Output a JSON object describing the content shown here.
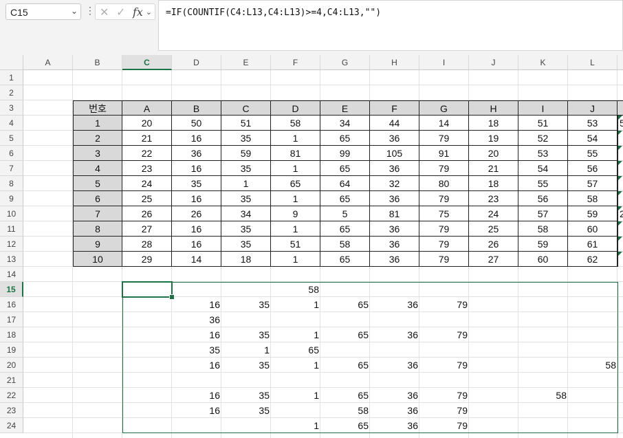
{
  "name_box": {
    "value": "C15"
  },
  "formula_bar": {
    "formula": "=IF(COUNTIF(C4:L13,C4:L13)>=4,C4:L13,\"\")"
  },
  "column_headers": [
    "A",
    "B",
    "C",
    "D",
    "E",
    "F",
    "G",
    "H",
    "I",
    "J",
    "K",
    "L"
  ],
  "row_headers": [
    "1",
    "2",
    "3",
    "4",
    "5",
    "6",
    "7",
    "8",
    "9",
    "10",
    "11",
    "12",
    "13",
    "14",
    "15",
    "16",
    "17",
    "18",
    "19",
    "20",
    "21",
    "22",
    "23",
    "24"
  ],
  "selected": {
    "column": "C",
    "row": "15"
  },
  "table": {
    "header": [
      "번호",
      "A",
      "B",
      "C",
      "D",
      "E",
      "F",
      "G",
      "H",
      "I",
      "J"
    ],
    "rows": [
      [
        "1",
        "20",
        "50",
        "51",
        "58",
        "34",
        "44",
        "14",
        "18",
        "51",
        "53"
      ],
      [
        "2",
        "21",
        "16",
        "35",
        "1",
        "65",
        "36",
        "79",
        "19",
        "52",
        "54"
      ],
      [
        "3",
        "22",
        "36",
        "59",
        "81",
        "99",
        "105",
        "91",
        "20",
        "53",
        "55"
      ],
      [
        "4",
        "23",
        "16",
        "35",
        "1",
        "65",
        "36",
        "79",
        "21",
        "54",
        "56"
      ],
      [
        "5",
        "24",
        "35",
        "1",
        "65",
        "64",
        "32",
        "80",
        "18",
        "55",
        "57"
      ],
      [
        "6",
        "25",
        "16",
        "35",
        "1",
        "65",
        "36",
        "79",
        "23",
        "56",
        "58"
      ],
      [
        "7",
        "26",
        "26",
        "34",
        "9",
        "5",
        "81",
        "75",
        "24",
        "57",
        "59"
      ],
      [
        "8",
        "27",
        "16",
        "35",
        "1",
        "65",
        "36",
        "79",
        "25",
        "58",
        "60"
      ],
      [
        "9",
        "28",
        "16",
        "35",
        "51",
        "58",
        "36",
        "79",
        "26",
        "59",
        "61"
      ],
      [
        "10",
        "29",
        "14",
        "18",
        "1",
        "65",
        "36",
        "79",
        "27",
        "60",
        "62"
      ]
    ],
    "overflow_col_M": [
      "5",
      "",
      "",
      "",
      "",
      "",
      "2",
      "",
      "",
      ""
    ]
  },
  "result": {
    "rows": [
      [
        "",
        "",
        "",
        "58",
        "",
        "",
        "",
        "",
        "",
        ""
      ],
      [
        "",
        "16",
        "35",
        "1",
        "65",
        "36",
        "79",
        "",
        "",
        ""
      ],
      [
        "",
        "36",
        "",
        "",
        "",
        "",
        "",
        "",
        "",
        ""
      ],
      [
        "",
        "16",
        "35",
        "1",
        "65",
        "36",
        "79",
        "",
        "",
        ""
      ],
      [
        "",
        "35",
        "1",
        "65",
        "",
        "",
        "",
        "",
        "",
        ""
      ],
      [
        "",
        "16",
        "35",
        "1",
        "65",
        "36",
        "79",
        "",
        "",
        "58"
      ],
      [
        "",
        "",
        "",
        "",
        "",
        "",
        "",
        "",
        "",
        ""
      ],
      [
        "",
        "16",
        "35",
        "1",
        "65",
        "36",
        "79",
        "",
        "58",
        ""
      ],
      [
        "",
        "16",
        "35",
        "",
        "58",
        "36",
        "79",
        "",
        "",
        ""
      ],
      [
        "",
        "",
        "",
        "1",
        "65",
        "36",
        "79",
        "",
        "",
        ""
      ]
    ]
  }
}
